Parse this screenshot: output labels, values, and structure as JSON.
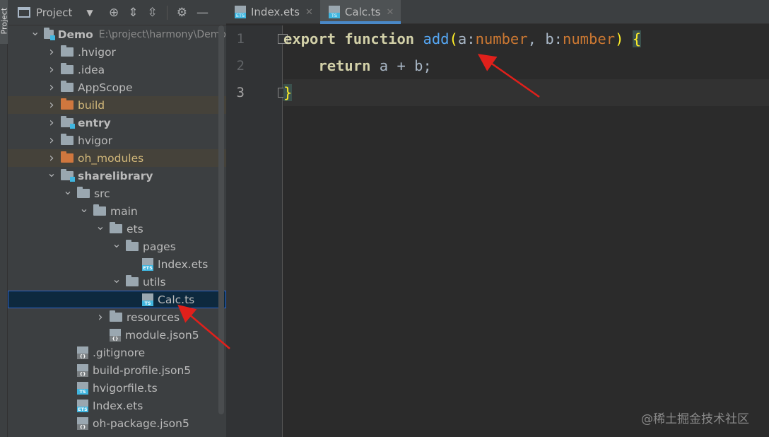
{
  "sidebar_stripe": {
    "label": "Project"
  },
  "panel": {
    "title": "Project",
    "tree": [
      {
        "label": "Demo",
        "path": "E:\\project\\harmony\\Demo",
        "kind": "module",
        "level": 0,
        "expanded": true,
        "bold": true
      },
      {
        "label": ".hvigor",
        "kind": "folder",
        "level": 1,
        "expanded": false
      },
      {
        "label": ".idea",
        "kind": "folder",
        "level": 1,
        "expanded": false
      },
      {
        "label": "AppScope",
        "kind": "folder",
        "level": 1,
        "expanded": false
      },
      {
        "label": "build",
        "kind": "folder-excluded",
        "level": 1,
        "expanded": false
      },
      {
        "label": "entry",
        "kind": "module",
        "level": 1,
        "expanded": false,
        "bold": true
      },
      {
        "label": "hvigor",
        "kind": "folder",
        "level": 1,
        "expanded": false
      },
      {
        "label": "oh_modules",
        "kind": "folder-excluded",
        "level": 1,
        "expanded": false
      },
      {
        "label": "sharelibrary",
        "kind": "module",
        "level": 1,
        "expanded": true,
        "bold": true
      },
      {
        "label": "src",
        "kind": "folder",
        "level": 2,
        "expanded": true
      },
      {
        "label": "main",
        "kind": "folder",
        "level": 3,
        "expanded": true
      },
      {
        "label": "ets",
        "kind": "folder",
        "level": 4,
        "expanded": true
      },
      {
        "label": "pages",
        "kind": "folder",
        "level": 5,
        "expanded": true
      },
      {
        "label": "Index.ets",
        "kind": "file-ets",
        "level": 6
      },
      {
        "label": "utils",
        "kind": "folder",
        "level": 5,
        "expanded": true
      },
      {
        "label": "Calc.ts",
        "kind": "file-ts",
        "level": 6,
        "selected": true
      },
      {
        "label": "resources",
        "kind": "folder",
        "level": 4,
        "expanded": false
      },
      {
        "label": "module.json5",
        "kind": "file-cfg",
        "level": 4
      },
      {
        "label": ".gitignore",
        "kind": "file-cfg",
        "level": 2
      },
      {
        "label": "build-profile.json5",
        "kind": "file-cfg",
        "level": 2
      },
      {
        "label": "hvigorfile.ts",
        "kind": "file-ts",
        "level": 2
      },
      {
        "label": "Index.ets",
        "kind": "file-ets",
        "level": 2
      },
      {
        "label": "oh-package.json5",
        "kind": "file-cfg",
        "level": 2
      }
    ]
  },
  "editor": {
    "tabs": [
      {
        "label": "Index.ets",
        "icon": "ETS",
        "active": false
      },
      {
        "label": "Calc.ts",
        "icon": "TS",
        "active": true
      }
    ],
    "line_numbers": [
      "1",
      "2",
      "3"
    ],
    "code": {
      "l1": {
        "kw": "export",
        "kw2": "function",
        "fn": "add",
        "open": "(",
        "a": "a",
        "c1": ":",
        "t1": "number",
        "comma": ", ",
        "b": "b",
        "c2": ":",
        "t2": "number",
        "close": ")",
        "brace": "{"
      },
      "l2": {
        "kw": "return",
        "expr": " a + b;"
      },
      "l3": {
        "brace": "}"
      }
    }
  },
  "watermark": "@稀土掘金技术社区"
}
